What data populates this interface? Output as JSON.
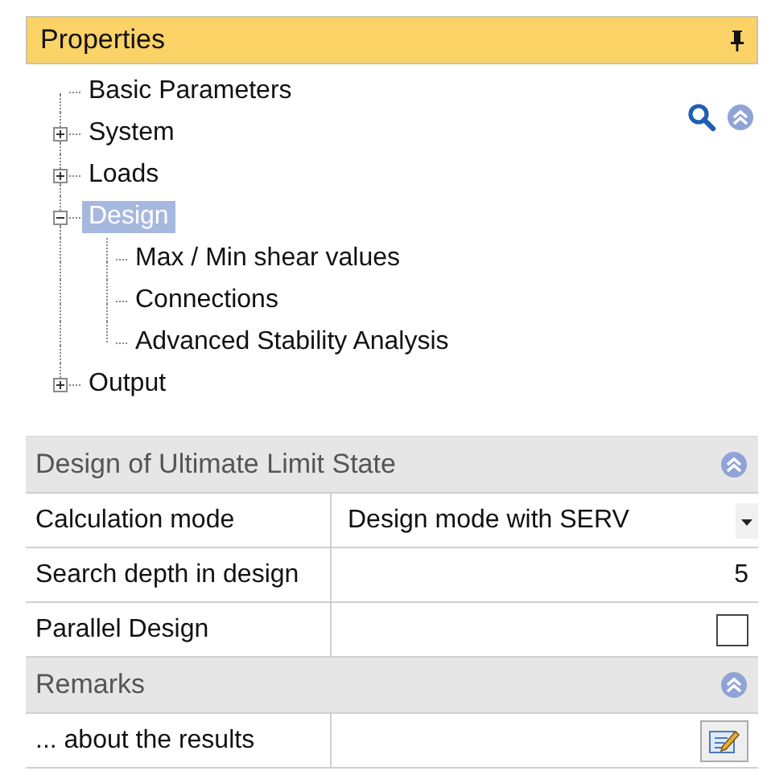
{
  "panel": {
    "title": "Properties"
  },
  "tree": [
    {
      "label": "Basic Parameters",
      "selected": false
    },
    {
      "label": "System",
      "expanded": false,
      "selected": false
    },
    {
      "label": "Loads",
      "expanded": false,
      "selected": false
    },
    {
      "label": "Design",
      "expanded": true,
      "selected": true,
      "children": [
        {
          "label": "Max / Min shear values",
          "selected": false
        },
        {
          "label": "Connections",
          "selected": false
        },
        {
          "label": "Advanced Stability Analysis",
          "selected": false
        }
      ]
    },
    {
      "label": "Output",
      "expanded": false,
      "selected": false
    }
  ],
  "sections": [
    {
      "title": "Design of Ultimate Limit State",
      "expanded": true,
      "rows": [
        {
          "kind": "dropdown",
          "label": "Calculation mode",
          "value": "Design mode with SERV"
        },
        {
          "kind": "number",
          "label": "Search depth in design",
          "value": "5"
        },
        {
          "kind": "checkbox",
          "label": "Parallel Design",
          "checked": false
        }
      ]
    },
    {
      "title": "Remarks",
      "expanded": true,
      "rows": [
        {
          "kind": "button",
          "label": "... about the  results"
        }
      ]
    }
  ]
}
